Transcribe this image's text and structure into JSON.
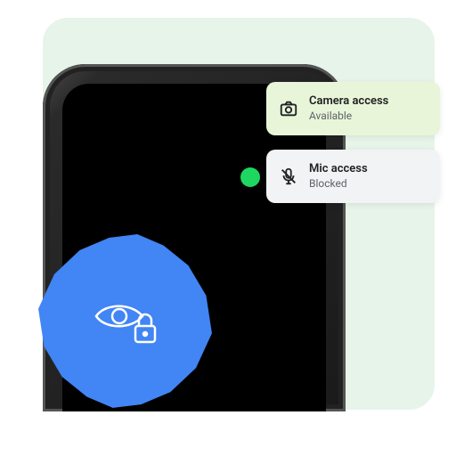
{
  "notifications": {
    "camera": {
      "title": "Camera access",
      "status": "Available"
    },
    "mic": {
      "title": "Mic access",
      "status": "Blocked"
    }
  },
  "icons": {
    "camera": "camera-icon",
    "mic_blocked": "mic-off-icon",
    "privacy": "eye-lock-icon",
    "indicator": "privacy-indicator-dot"
  },
  "colors": {
    "accent_blue": "#4285f4",
    "indicator_green": "#1ed760",
    "panel_bg": "#e6f4ea",
    "notif_camera_bg": "#e9f5d8",
    "notif_mic_bg": "#f1f3f4"
  }
}
